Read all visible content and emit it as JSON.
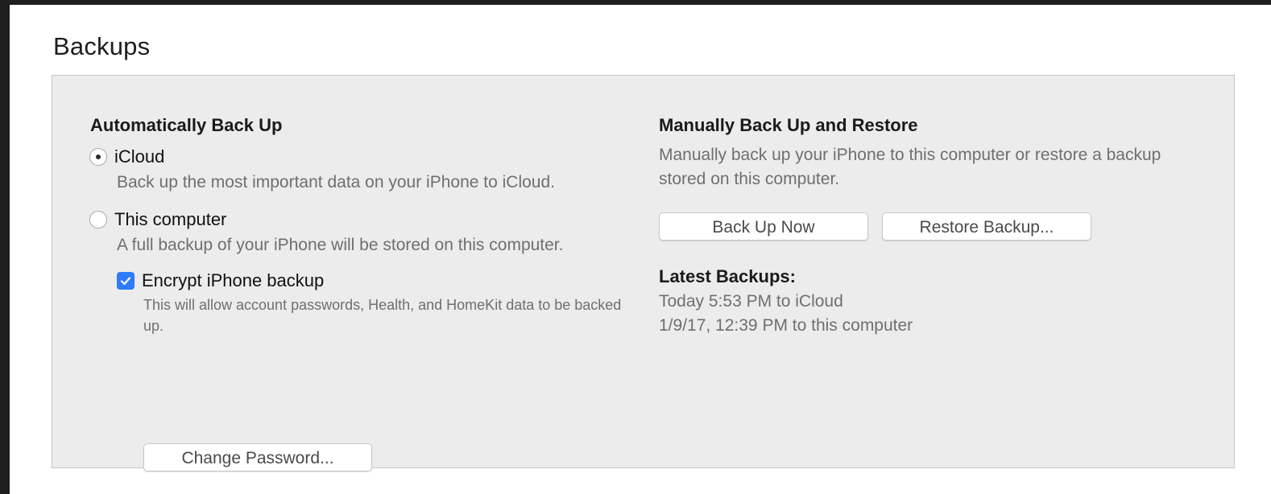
{
  "section": {
    "title": "Backups"
  },
  "auto": {
    "heading": "Automatically Back Up",
    "icloud": {
      "label": "iCloud",
      "description": "Back up the most important data on your iPhone to iCloud.",
      "selected": true
    },
    "computer": {
      "label": "This computer",
      "description": "A full backup of your iPhone will be stored on this computer.",
      "selected": false
    },
    "encrypt": {
      "label": "Encrypt iPhone backup",
      "checked": true,
      "description": "This will allow account passwords, Health, and HomeKit data to be backed up."
    },
    "change_password_label": "Change Password..."
  },
  "manual": {
    "heading": "Manually Back Up and Restore",
    "description": "Manually back up your iPhone to this computer or restore a backup stored on this computer.",
    "back_up_now_label": "Back Up Now",
    "restore_backup_label": "Restore Backup..."
  },
  "latest": {
    "heading": "Latest Backups:",
    "items": [
      "Today 5:53 PM to iCloud",
      "1/9/17, 12:39 PM to this computer"
    ]
  },
  "colors": {
    "checkbox_accent": "#2f7cf6",
    "panel_background": "#ececec",
    "outer_background": "#1f1f1f"
  }
}
